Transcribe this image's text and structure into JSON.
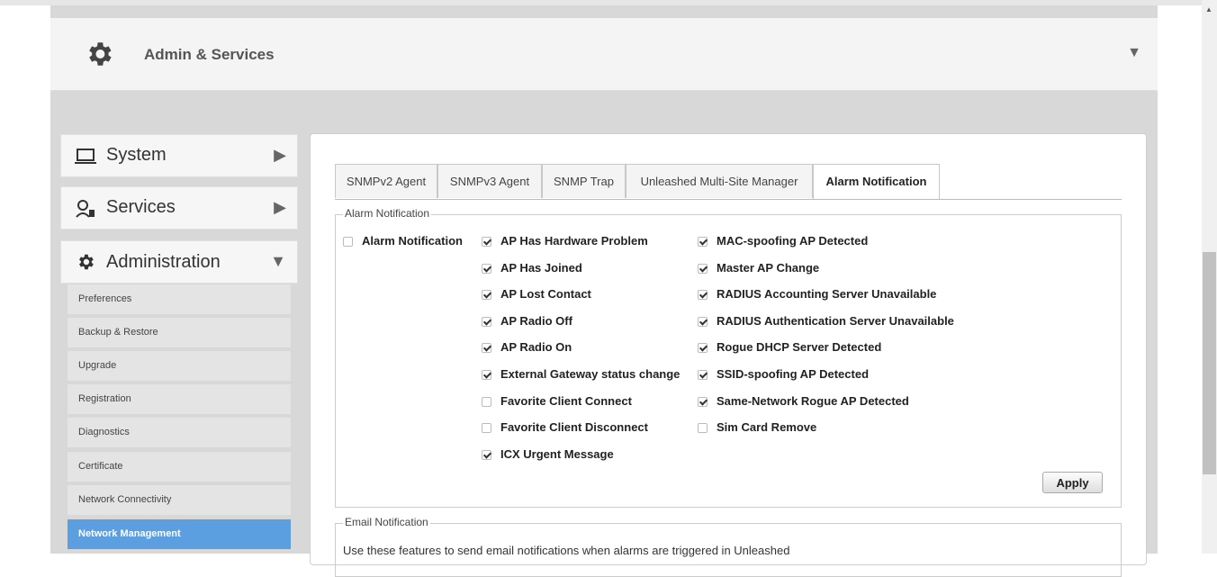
{
  "header": {
    "title": "Admin & Services"
  },
  "sidebar": {
    "sections": [
      {
        "label": "System"
      },
      {
        "label": "Services"
      },
      {
        "label": "Administration"
      }
    ],
    "admin_items": [
      {
        "label": "Preferences"
      },
      {
        "label": "Backup & Restore"
      },
      {
        "label": "Upgrade"
      },
      {
        "label": "Registration"
      },
      {
        "label": "Diagnostics"
      },
      {
        "label": "Certificate"
      },
      {
        "label": "Network Connectivity"
      },
      {
        "label": "Network Management"
      }
    ]
  },
  "tabs": [
    {
      "label": "SNMPv2 Agent"
    },
    {
      "label": "SNMPv3 Agent"
    },
    {
      "label": "SNMP Trap"
    },
    {
      "label": "Unleashed Multi-Site Manager"
    },
    {
      "label": "Alarm Notification"
    }
  ],
  "alarm": {
    "legend": "Alarm Notification",
    "master": {
      "label": "Alarm Notification",
      "checked": false
    },
    "col1": [
      {
        "label": "AP Has Hardware Problem",
        "checked": true
      },
      {
        "label": "AP Has Joined",
        "checked": true
      },
      {
        "label": "AP Lost Contact",
        "checked": true
      },
      {
        "label": "AP Radio Off",
        "checked": true
      },
      {
        "label": "AP Radio On",
        "checked": true
      },
      {
        "label": "External Gateway status change",
        "checked": true
      },
      {
        "label": "Favorite Client Connect",
        "checked": false
      },
      {
        "label": "Favorite Client Disconnect",
        "checked": false
      },
      {
        "label": "ICX Urgent Message",
        "checked": true
      }
    ],
    "col2": [
      {
        "label": "MAC-spoofing AP Detected",
        "checked": true
      },
      {
        "label": "Master AP Change",
        "checked": true
      },
      {
        "label": "RADIUS Accounting Server Unavailable",
        "checked": true
      },
      {
        "label": "RADIUS Authentication Server Unavailable",
        "checked": true
      },
      {
        "label": "Rogue DHCP Server Detected",
        "checked": true
      },
      {
        "label": "SSID-spoofing AP Detected",
        "checked": true
      },
      {
        "label": "Same-Network Rogue AP Detected",
        "checked": true
      },
      {
        "label": "Sim Card Remove",
        "checked": false
      }
    ],
    "apply_label": "Apply"
  },
  "email": {
    "legend": "Email Notification",
    "description": "Use these features to send email notifications when alarms are triggered in Unleashed"
  },
  "colors": {
    "accent": "#5b9fe0",
    "panel": "#d8d8d8"
  }
}
